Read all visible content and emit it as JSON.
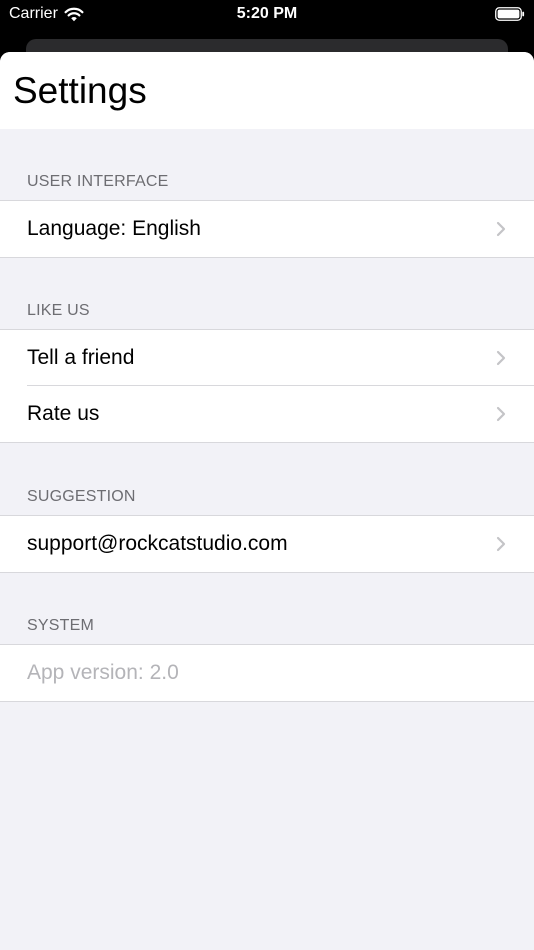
{
  "status_bar": {
    "carrier": "Carrier",
    "time": "5:20 PM"
  },
  "page": {
    "title": "Settings"
  },
  "sections": [
    {
      "header": "USER INTERFACE",
      "rows": [
        {
          "label": "Language: English"
        }
      ]
    },
    {
      "header": "LIKE US",
      "rows": [
        {
          "label": "Tell a friend"
        },
        {
          "label": "Rate us"
        }
      ]
    },
    {
      "header": "SUGGESTION",
      "rows": [
        {
          "label": "support@rockcatstudio.com"
        }
      ]
    },
    {
      "header": "SYSTEM",
      "rows": [
        {
          "label": "App version: 2.0"
        }
      ]
    }
  ],
  "icons": {
    "wifi": "wifi-icon",
    "battery": "battery-icon",
    "chevron": "chevron-right-icon"
  },
  "colors": {
    "background_grouped": "#f2f2f7",
    "section_header_text": "#6d6d72",
    "disabled_text": "#b4b4b8",
    "chevron": "#c4c4c7"
  }
}
